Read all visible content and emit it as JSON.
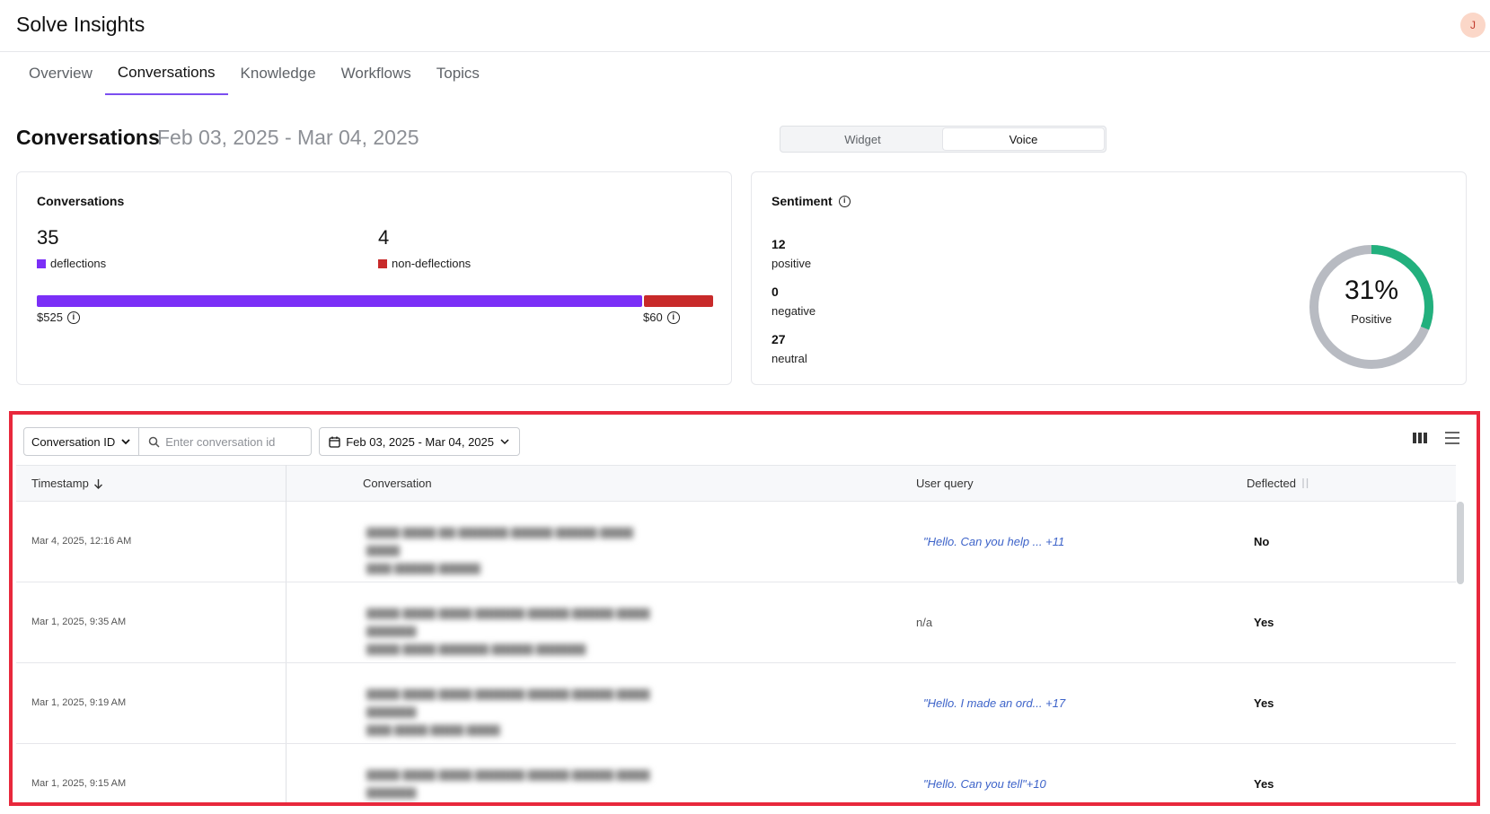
{
  "app": {
    "title": "Solve Insights",
    "avatar_initial": "J"
  },
  "tabs": [
    {
      "label": "Overview"
    },
    {
      "label": "Conversations",
      "active": true
    },
    {
      "label": "Knowledge"
    },
    {
      "label": "Workflows"
    },
    {
      "label": "Topics"
    }
  ],
  "heading": {
    "title": "Conversations",
    "date_range": "Feb 03, 2025 - Mar 04, 2025"
  },
  "channel_toggle": {
    "options": [
      "Widget",
      "Voice"
    ],
    "selected": "Voice"
  },
  "conversations_card": {
    "title": "Conversations",
    "deflections": {
      "count": "35",
      "label": "deflections",
      "amount": "$525",
      "color": "#7b2ff7"
    },
    "non_deflections": {
      "count": "4",
      "label": "non-deflections",
      "amount": "$60",
      "color": "#c82a2a"
    },
    "deflection_share": 0.8974
  },
  "sentiment_card": {
    "title": "Sentiment",
    "positive": {
      "count": "12",
      "label": "positive"
    },
    "negative": {
      "count": "0",
      "label": "negative"
    },
    "neutral": {
      "count": "27",
      "label": "neutral"
    },
    "positive_percent": "31%",
    "positive_fraction": 0.31,
    "donut_label": "Positive",
    "colors": {
      "positive": "#22b07d",
      "rest": "#b8bbc2"
    }
  },
  "filters": {
    "field_select": "Conversation ID",
    "search_placeholder": "Enter conversation id",
    "date_range": "Feb 03, 2025 - Mar 04, 2025"
  },
  "table": {
    "columns": {
      "timestamp": "Timestamp",
      "conversation": "Conversation",
      "user_query": "User query",
      "deflected": "Deflected"
    },
    "rows": [
      {
        "timestamp": "Mar 4, 2025, 12:16 AM",
        "user_query": "\"Hello. Can you help ...  +11",
        "deflected": "No"
      },
      {
        "timestamp": "Mar 1, 2025, 9:35 AM",
        "user_query": "n/a",
        "deflected": "Yes"
      },
      {
        "timestamp": "Mar 1, 2025, 9:19 AM",
        "user_query": "\"Hello. I made an ord...  +17",
        "deflected": "Yes"
      },
      {
        "timestamp": "Mar 1, 2025, 9:15 AM",
        "user_query": "\"Hello. Can you tell\"+10",
        "deflected": "Yes"
      }
    ]
  },
  "icons": {
    "search": "search-icon",
    "calendar": "calendar-icon",
    "chevron": "chevron-down-icon",
    "columns": "columns-icon",
    "density": "density-icon",
    "info": "info-icon",
    "sort_down": "arrow-down-icon",
    "sort": "sort-icon"
  }
}
